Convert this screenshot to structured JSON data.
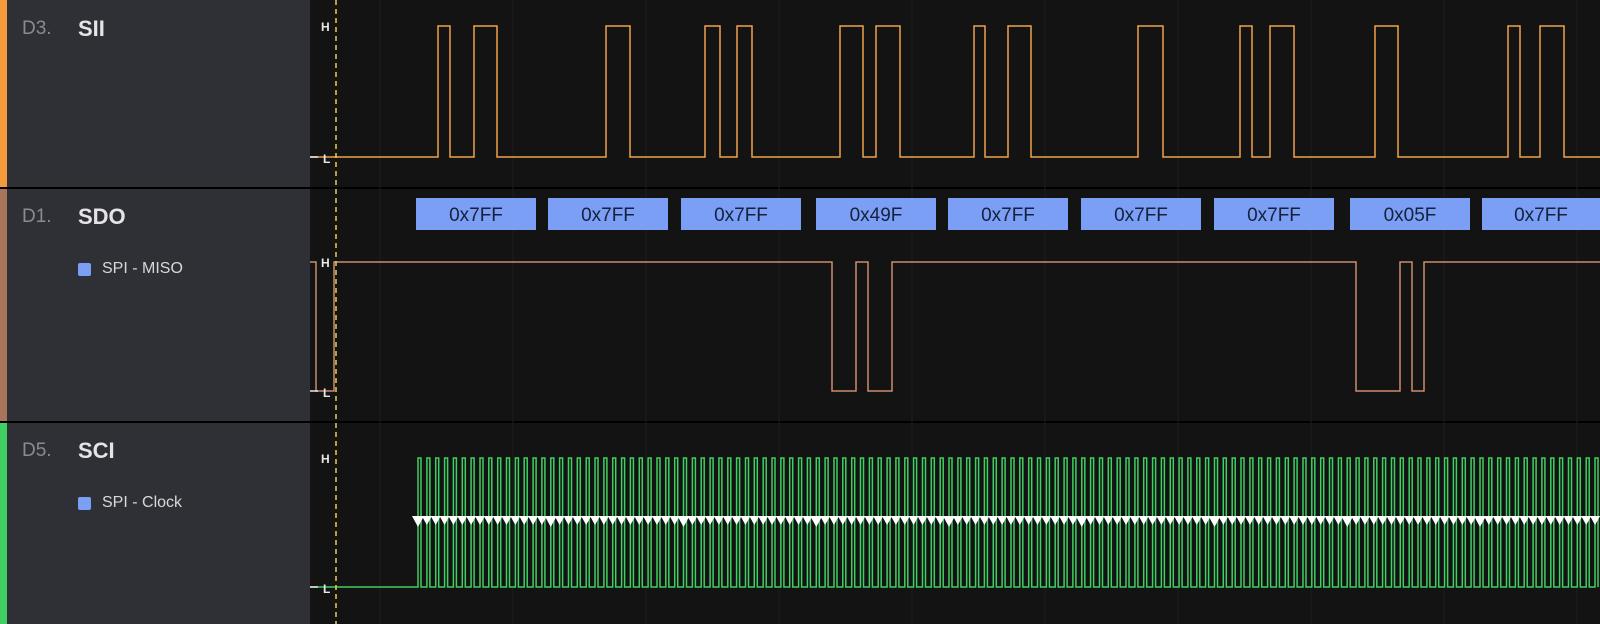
{
  "channels": [
    {
      "number": "D3.",
      "name": "SII",
      "color": "#f0a24a",
      "analyzer": null
    },
    {
      "number": "D1.",
      "name": "SDO",
      "color": "#b77a62",
      "analyzer": "SPI - MISO"
    },
    {
      "number": "D5.",
      "name": "SCI",
      "color": "#3fcf63",
      "analyzer": "SPI - Clock"
    }
  ],
  "level_labels": {
    "high": "H",
    "low": "L"
  },
  "decoded_frames": [
    "0x7FF",
    "0x7FF",
    "0x7FF",
    "0x49F",
    "0x7FF",
    "0x7FF",
    "0x7FF",
    "0x05F",
    "0x7FF"
  ],
  "colors": {
    "analyzer_marker": "#7b9ff5",
    "decode_box": "#7b9ff5",
    "cursor": "#e7d04f",
    "waveform_background": "#131313",
    "sidebar_background": "#2f3035"
  }
}
